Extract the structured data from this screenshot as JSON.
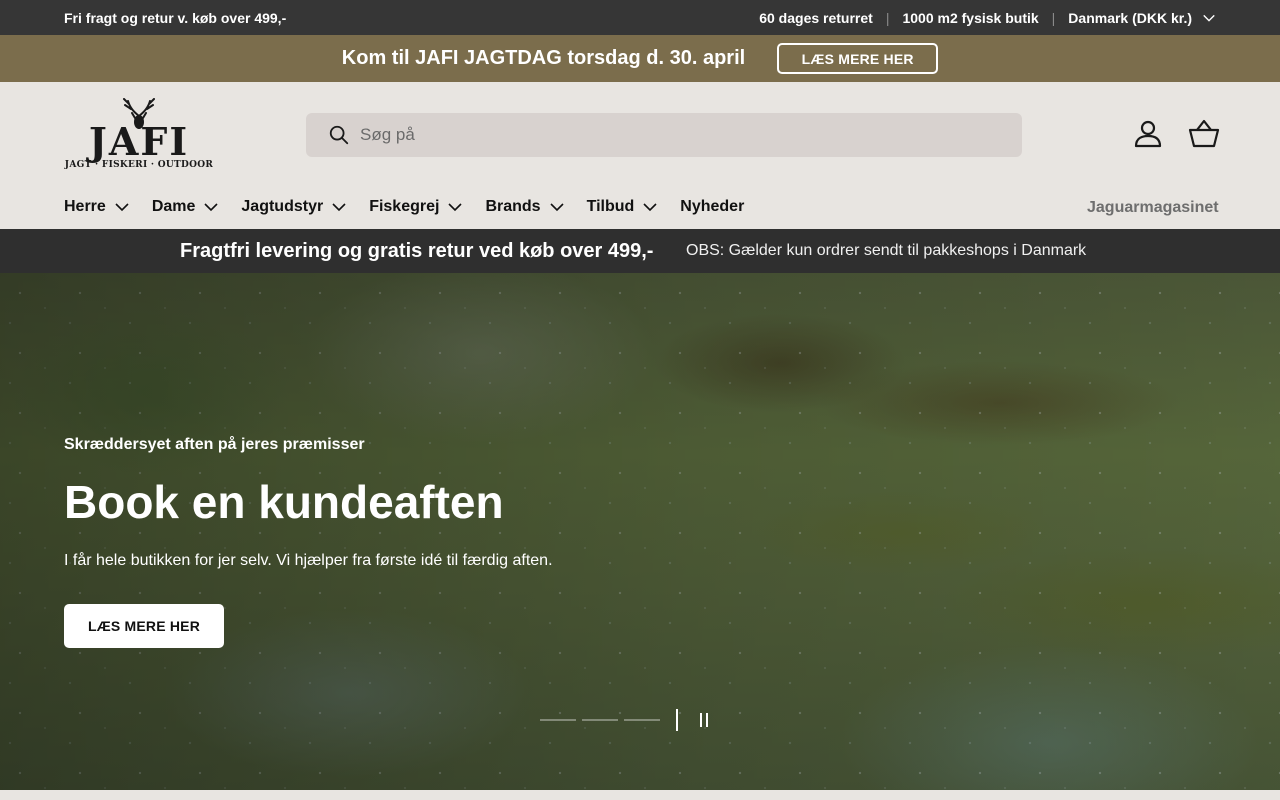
{
  "topbar": {
    "left_text": "Fri fragt og retur v. køb over 499,-",
    "items": [
      "60 dages returret",
      "1000 m2 fysisk butik"
    ],
    "separator": "|",
    "country": "Danmark (DKK kr.)"
  },
  "announcement": {
    "text": "Kom til JAFI JAGTDAG torsdag d. 30. april",
    "button": "LÆS MERE HER"
  },
  "header": {
    "logo_word": "JAFI",
    "logo_tagline": "JAGT · FISKERI · OUTDOOR",
    "search_placeholder": "Søg på"
  },
  "nav": {
    "items": [
      {
        "label": "Herre",
        "has_dropdown": true
      },
      {
        "label": "Dame",
        "has_dropdown": true
      },
      {
        "label": "Jagtudstyr",
        "has_dropdown": true
      },
      {
        "label": "Fiskegrej",
        "has_dropdown": true
      },
      {
        "label": "Brands",
        "has_dropdown": true
      },
      {
        "label": "Tilbud",
        "has_dropdown": true
      },
      {
        "label": "Nyheder",
        "has_dropdown": false
      }
    ],
    "right_link": "Jaguarmagasinet"
  },
  "strip": {
    "main": "Fragtfri levering og gratis retur ved køb over 499,-",
    "sub": "OBS: Gælder kun ordrer sendt til pakkeshops i Danmark"
  },
  "hero": {
    "kicker": "Skræddersyet aften på jeres præmisser",
    "title": "Book en kundeaften",
    "description": "I får hele butikken for jer selv. Vi hjælper fra første idé til færdig aften.",
    "button": "LÆS MERE HER"
  },
  "colors": {
    "topbar": "#363636",
    "announcement": "#7b6d4c",
    "header_bg": "#e8e5e1",
    "search_bg": "#d8d2cf",
    "strip": "#2f2f2f"
  },
  "icons": {
    "search": "search-icon",
    "account": "user-icon",
    "cart": "basket-icon",
    "dropdown": "chevron-down-icon",
    "pause": "pause-icon"
  }
}
